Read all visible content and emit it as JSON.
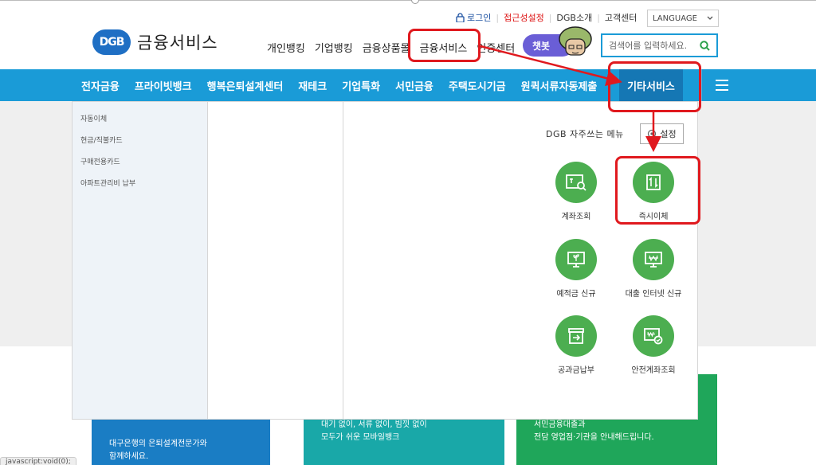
{
  "util": {
    "login": "로그인",
    "accessibility": "접근성설정",
    "about": "DGB소개",
    "support": "고객센터",
    "language": "LANGUAGE"
  },
  "brand": {
    "logo": "DGB",
    "title": "금융서비스"
  },
  "topnav": [
    "개인뱅킹",
    "기업뱅킹",
    "금융상품몰",
    "금융서비스",
    "인증센터"
  ],
  "chatbot": "챗봇",
  "search": {
    "placeholder": "검색어를 입력하세요."
  },
  "gnb": {
    "items": [
      "전자금융",
      "프라이빗뱅크",
      "행복은퇴설계센터",
      "재테크",
      "기업특화",
      "서민금융",
      "주택도시기금",
      "원퀵서류자동제출"
    ],
    "active": "기타서비스"
  },
  "submenu": [
    "자동이체",
    "현금/직불카드",
    "구매전용카드",
    "아파트관리비 납부"
  ],
  "quick": {
    "title": "DGB 자주쓰는 메뉴",
    "settings": "설정",
    "items": [
      "계좌조회",
      "즉시이체",
      "예적금 신규",
      "대출 인터넷 신규",
      "공과금납부",
      "안전계좌조회"
    ]
  },
  "cards": {
    "c1": [
      "대구은행의 은퇴설계전문가와",
      "함께하세요."
    ],
    "c2": [
      "대기 없이, 서류 없이, 빔낏 없이",
      "모두가 쉬운 모바일뱅크"
    ],
    "c3": [
      "서민금융대출과",
      "전담 영업점·기관을 안내해드립니다."
    ]
  },
  "status": "javascript:void(0);",
  "colors": {
    "brand_blue": "#1a9bd7",
    "quick_green": "#4cae50",
    "highlight_red": "#e0191e"
  }
}
